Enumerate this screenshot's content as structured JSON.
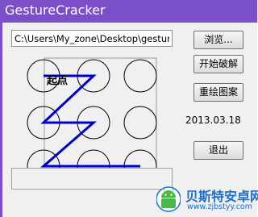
{
  "window": {
    "title": "GestureCracker"
  },
  "path_field": {
    "value": "C:\\Users\\My_zone\\Desktop\\gesture"
  },
  "buttons": {
    "browse": "浏览...",
    "crack": "开始破解",
    "redraw": "重绘图案",
    "exit": "退出"
  },
  "date_label": "2013.03.18",
  "pattern": {
    "start_label": "起点",
    "grid_rows": 3,
    "grid_cols": 3,
    "sequence": [
      1,
      2,
      4,
      5,
      7,
      8,
      9
    ],
    "line_color": "#0000cc"
  },
  "watermark": {
    "title": "贝斯特安卓网",
    "url": "www.zjbstyy.com",
    "accent": "#1a6fd0"
  }
}
